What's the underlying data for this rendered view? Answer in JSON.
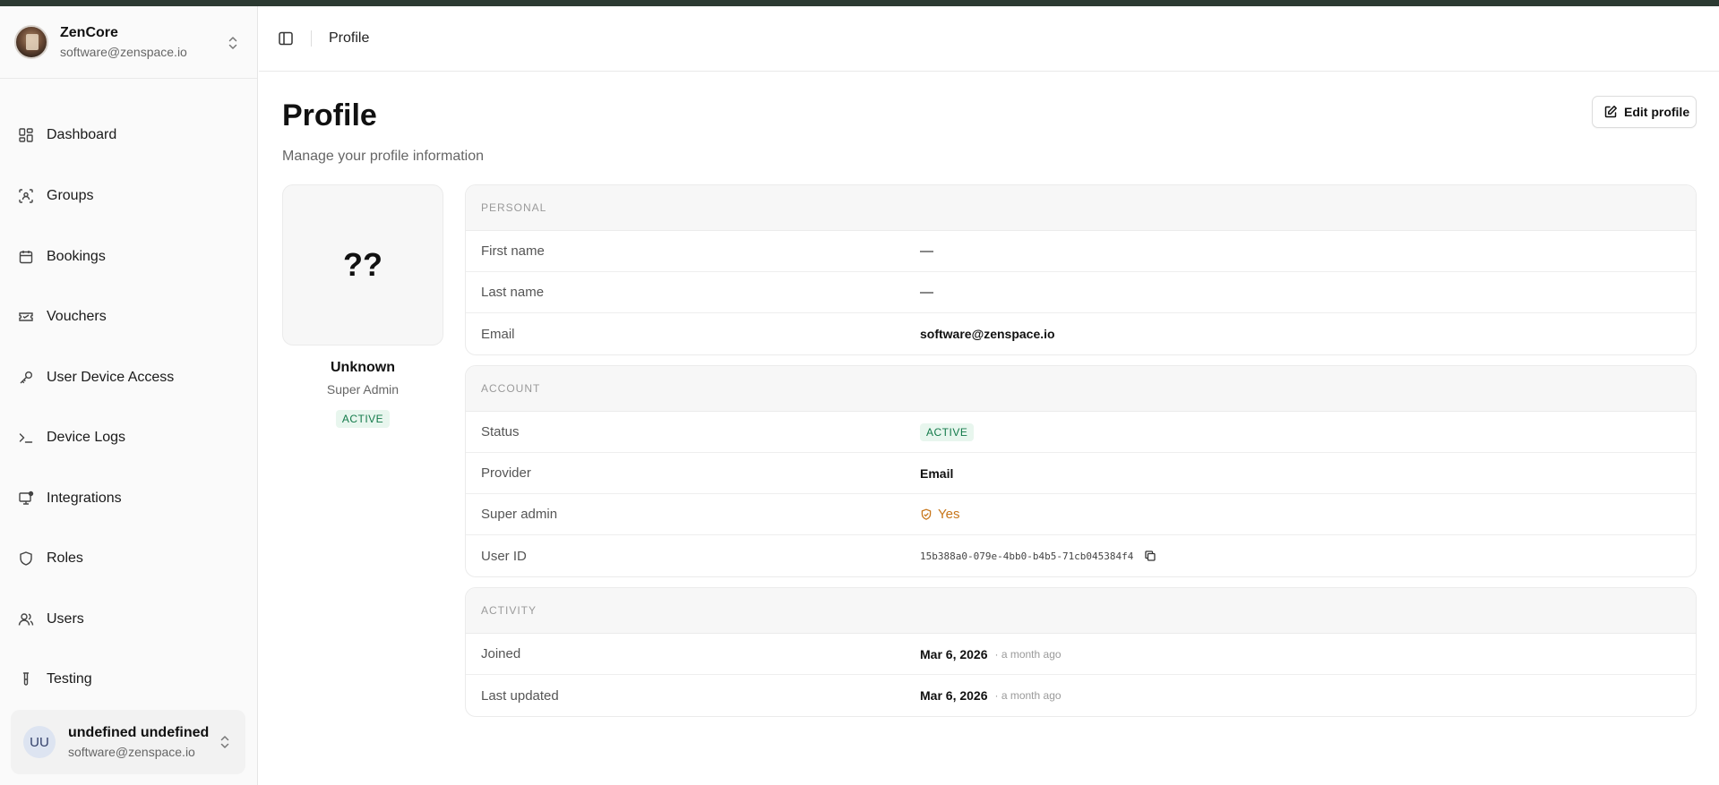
{
  "brand": {
    "name": "ZenCore",
    "email": "software@zenspace.io"
  },
  "nav": {
    "items": [
      {
        "label": "Dashboard"
      },
      {
        "label": "Groups"
      },
      {
        "label": "Bookings"
      },
      {
        "label": "Vouchers"
      },
      {
        "label": "User Device Access"
      },
      {
        "label": "Device Logs"
      },
      {
        "label": "Integrations"
      },
      {
        "label": "Roles"
      },
      {
        "label": "Users"
      },
      {
        "label": "Testing"
      }
    ]
  },
  "user": {
    "initials": "UU",
    "name": "undefined undefined",
    "email": "software@zenspace.io"
  },
  "header": {
    "breadcrumb": "Profile"
  },
  "page": {
    "title": "Profile",
    "subtitle": "Manage your profile information",
    "edit_label": "Edit profile"
  },
  "profile": {
    "avatar_text": "??",
    "name": "Unknown",
    "role": "Super Admin",
    "status": "ACTIVE"
  },
  "personal": {
    "heading": "PERSONAL",
    "first_name_label": "First name",
    "first_name": "—",
    "last_name_label": "Last name",
    "last_name": "—",
    "email_label": "Email",
    "email": "software@zenspace.io"
  },
  "account": {
    "heading": "ACCOUNT",
    "status_label": "Status",
    "status": "ACTIVE",
    "provider_label": "Provider",
    "provider": "Email",
    "super_admin_label": "Super admin",
    "super_admin": "Yes",
    "user_id_label": "User ID",
    "user_id": "15b388a0-079e-4bb0-b4b5-71cb045384f4"
  },
  "activity": {
    "heading": "ACTIVITY",
    "joined_label": "Joined",
    "joined": "Mar 6, 2026",
    "joined_rel": "· a month ago",
    "updated_label": "Last updated",
    "updated": "Mar 6, 2026",
    "updated_rel": "· a month ago"
  },
  "colors": {
    "accent_green": "#137a4a",
    "badge_bg": "#e8f6ee",
    "warning": "#c8761a",
    "topbar": "#2c3a32"
  },
  "icons": {
    "nav": [
      "dashboard-icon",
      "groups-icon",
      "calendar-icon",
      "ticket-icon",
      "key-icon",
      "terminal-icon",
      "monitor-icon",
      "shield-icon",
      "users-icon",
      "test-tube-icon"
    ]
  }
}
